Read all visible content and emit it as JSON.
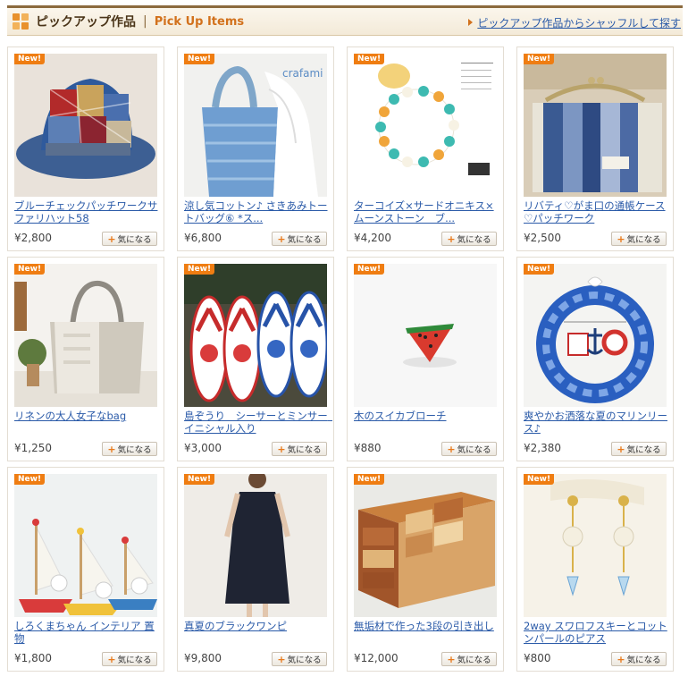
{
  "header": {
    "title": "ピックアップ作品",
    "separator": "|",
    "subtitle": "Pick Up Items",
    "shuffle_link": "ピックアップ作品からシャッフルして探す"
  },
  "common": {
    "badge": "New!",
    "like_label": "気になる",
    "like_plus": "+"
  },
  "items": [
    {
      "title": "ブルーチェックパッチワークサファリハット58",
      "price": "¥2,800",
      "image": "patchwork-hat"
    },
    {
      "title": "涼し気コットン♪ さきあみトートバッグ⑥ *ス...",
      "price": "¥6,800",
      "image": "blue-tote-bag",
      "watermark": "crafami"
    },
    {
      "title": "ターコイズ×サードオニキス×ムーンストーン　ブ...",
      "price": "¥4,200",
      "image": "turquoise-bracelet"
    },
    {
      "title": "リバティ♡がま口の通帳ケース♡パッチワーク",
      "price": "¥2,500",
      "image": "liberty-pouch"
    },
    {
      "title": "リネンの大人女子なbag",
      "price": "¥1,250",
      "image": "linen-bag"
    },
    {
      "title": "島ぞうり　シーサーとミンサー　イニシャル入り",
      "price": "¥3,000",
      "image": "shima-zouri-sandals"
    },
    {
      "title": "木のスイカブローチ",
      "price": "¥880",
      "image": "watermelon-brooch"
    },
    {
      "title": "爽やかお洒落な夏のマリンリース♪",
      "price": "¥2,380",
      "image": "marine-wreath"
    },
    {
      "title": "しろくまちゃん インテリア 置物",
      "price": "¥1,800",
      "image": "polar-bear-boats"
    },
    {
      "title": "真夏のブラックワンピ",
      "price": "¥9,800",
      "image": "black-dress"
    },
    {
      "title": "無垢材で作った3段の引き出し",
      "price": "¥12,000",
      "image": "wooden-drawers"
    },
    {
      "title": "2way スワロフスキーとコットンパールのピアス",
      "price": "¥800",
      "image": "pearl-earrings"
    }
  ]
}
